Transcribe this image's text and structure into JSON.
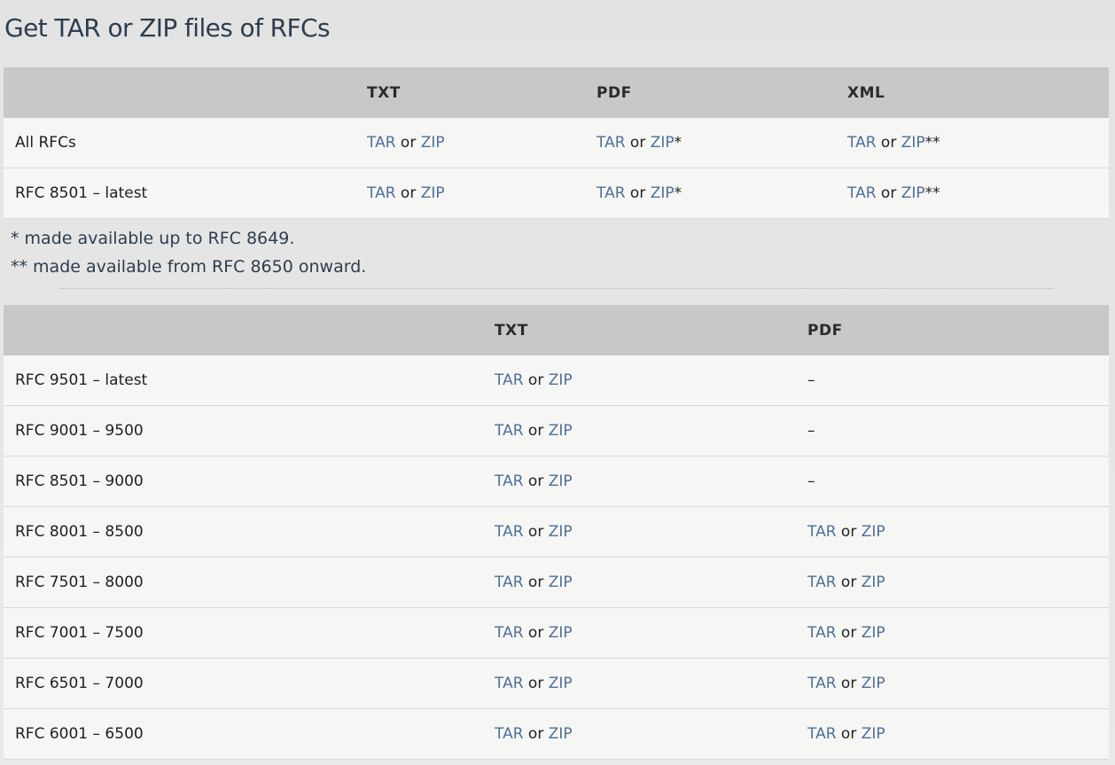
{
  "page": {
    "title": "Get TAR or ZIP files of RFCs"
  },
  "table1": {
    "headers": [
      "",
      "TXT",
      "PDF",
      "XML"
    ],
    "rows": [
      {
        "label": "All RFCs",
        "txt": {
          "tar": "TAR",
          "or": "or",
          "zip": "ZIP",
          "mark": ""
        },
        "pdf": {
          "tar": "TAR",
          "or": "or",
          "zip": "ZIP",
          "mark": "*"
        },
        "xml": {
          "tar": "TAR",
          "or": "or",
          "zip": "ZIP",
          "mark": "**"
        }
      },
      {
        "label": "RFC 8501 – latest",
        "txt": {
          "tar": "TAR",
          "or": "or",
          "zip": "ZIP",
          "mark": ""
        },
        "pdf": {
          "tar": "TAR",
          "or": "or",
          "zip": "ZIP",
          "mark": "*"
        },
        "xml": {
          "tar": "TAR",
          "or": "or",
          "zip": "ZIP",
          "mark": "**"
        }
      }
    ]
  },
  "notes": [
    "* made available up to RFC 8649.",
    "** made available from RFC 8650 onward."
  ],
  "table2": {
    "headers": [
      "",
      "TXT",
      "PDF"
    ],
    "rows": [
      {
        "label": "RFC 9501 – latest",
        "txt": {
          "tar": "TAR",
          "or": "or",
          "zip": "ZIP"
        },
        "pdf": {
          "dash": "–"
        }
      },
      {
        "label": "RFC 9001 – 9500",
        "txt": {
          "tar": "TAR",
          "or": "or",
          "zip": "ZIP"
        },
        "pdf": {
          "dash": "–"
        }
      },
      {
        "label": "RFC 8501 – 9000",
        "txt": {
          "tar": "TAR",
          "or": "or",
          "zip": "ZIP"
        },
        "pdf": {
          "dash": "–"
        }
      },
      {
        "label": "RFC 8001 – 8500",
        "txt": {
          "tar": "TAR",
          "or": "or",
          "zip": "ZIP"
        },
        "pdf": {
          "tar": "TAR",
          "or": "or",
          "zip": "ZIP"
        }
      },
      {
        "label": "RFC 7501 – 8000",
        "txt": {
          "tar": "TAR",
          "or": "or",
          "zip": "ZIP"
        },
        "pdf": {
          "tar": "TAR",
          "or": "or",
          "zip": "ZIP"
        }
      },
      {
        "label": "RFC 7001 – 7500",
        "txt": {
          "tar": "TAR",
          "or": "or",
          "zip": "ZIP"
        },
        "pdf": {
          "tar": "TAR",
          "or": "or",
          "zip": "ZIP"
        }
      },
      {
        "label": "RFC 6501 – 7000",
        "txt": {
          "tar": "TAR",
          "or": "or",
          "zip": "ZIP"
        },
        "pdf": {
          "tar": "TAR",
          "or": "or",
          "zip": "ZIP"
        }
      },
      {
        "label": "RFC 6001 – 6500",
        "txt": {
          "tar": "TAR",
          "or": "or",
          "zip": "ZIP"
        },
        "pdf": {
          "tar": "TAR",
          "or": "or",
          "zip": "ZIP"
        }
      }
    ]
  },
  "colors": {
    "link": "#4f6f98",
    "header_bg": "#c8c8c8",
    "title": "#2e3d4d"
  }
}
